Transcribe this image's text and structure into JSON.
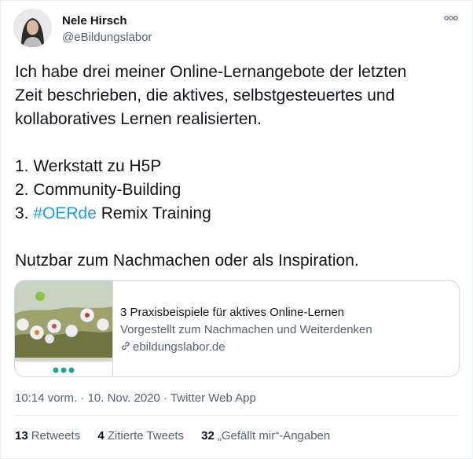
{
  "author": {
    "name": "Nele Hirsch",
    "handle": "@eBildungslabor"
  },
  "tweet": {
    "line1": "Ich habe drei meiner Online-Lernangebote der letzten",
    "line2": "Zeit beschrieben, die aktives, selbstgesteuertes und",
    "line3": "kollaboratives Lernen realisierten.",
    "item1": "1. Werkstatt zu H5P",
    "item2": "2. Community-Building",
    "item3_prefix": "3. ",
    "item3_hashtag": "#OERde",
    "item3_suffix": " Remix Training",
    "closing": "Nutzbar zum Nachmachen oder als Inspiration."
  },
  "card": {
    "title": "3 Praxisbeispiele für aktives Online-Lernen",
    "description": "Vorgestellt zum Nachmachen und Weiterdenken",
    "domain": "ebildungslabor.de"
  },
  "meta": {
    "time": "10:14 vorm.",
    "separator": " · ",
    "date": "10. Nov. 2020",
    "client": "Twitter Web App"
  },
  "stats": {
    "retweets_count": "13",
    "retweets_label": "Retweets",
    "quotes_count": "4",
    "quotes_label": "Zitierte Tweets",
    "likes_count": "32",
    "likes_label": "„Gefällt mir“-Angaben"
  },
  "colors": {
    "hashtag": "#1d9bf0",
    "secondary_text": "#536471",
    "border": "#cfd9de"
  },
  "icons": {
    "more": "more-horizontal-icon",
    "link": "link-icon"
  }
}
